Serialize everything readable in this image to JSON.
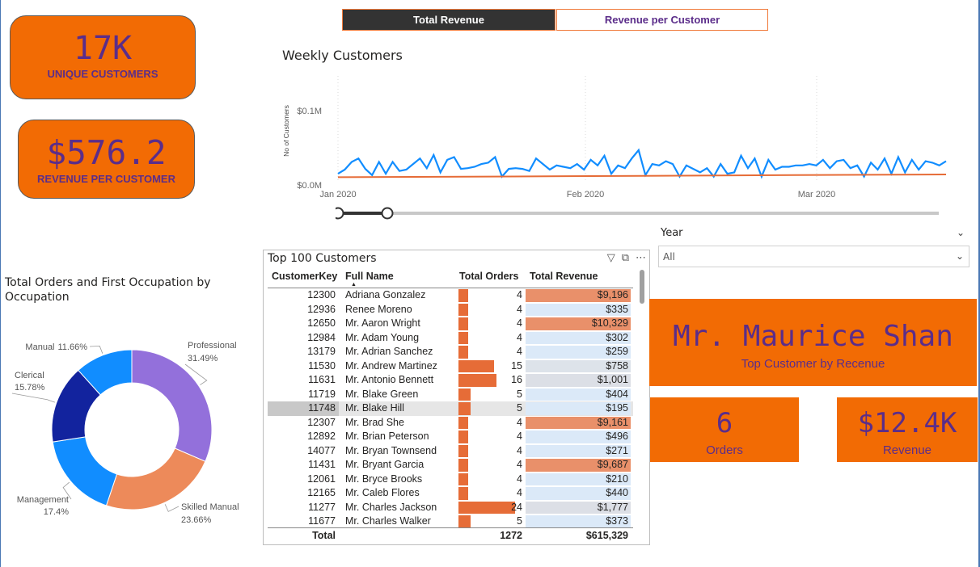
{
  "kpis": {
    "unique_customers": {
      "value": "17K",
      "label": "UNIQUE CUSTOMERS"
    },
    "revenue_per_customer": {
      "value": "$576.2",
      "label": "REVENUE PER CUSTOMER"
    }
  },
  "toggle": {
    "total_revenue": "Total Revenue",
    "revenue_per_customer": "Revenue per Customer",
    "active": "Total Revenue"
  },
  "weekly_chart": {
    "title": "Weekly Customers",
    "ylabel": "No of Customers",
    "y_ticks": [
      "$0.1M",
      "$0.0M"
    ],
    "x_ticks": [
      "Jan 2020",
      "Feb 2020",
      "Mar 2020"
    ]
  },
  "year_slicer": {
    "label": "Year",
    "value": "All"
  },
  "donut": {
    "title": "Total Orders and First Occupation by Occupation"
  },
  "table": {
    "title": "Top 100 Customers",
    "columns": [
      "CustomerKey",
      "Full Name",
      "Total Orders",
      "Total Revenue"
    ],
    "rows": [
      {
        "key": "12300",
        "name": "Adriana Gonzalez",
        "orders": 4,
        "revenue": "$9,196"
      },
      {
        "key": "12936",
        "name": "Renee Moreno",
        "orders": 4,
        "revenue": "$335"
      },
      {
        "key": "12650",
        "name": "Mr. Aaron Wright",
        "orders": 4,
        "revenue": "$10,329"
      },
      {
        "key": "12984",
        "name": "Mr. Adam Young",
        "orders": 4,
        "revenue": "$302"
      },
      {
        "key": "13179",
        "name": "Mr. Adrian Sanchez",
        "orders": 4,
        "revenue": "$259"
      },
      {
        "key": "11530",
        "name": "Mr. Andrew Martinez",
        "orders": 15,
        "revenue": "$758"
      },
      {
        "key": "11631",
        "name": "Mr. Antonio Bennett",
        "orders": 16,
        "revenue": "$1,001"
      },
      {
        "key": "11719",
        "name": "Mr. Blake Green",
        "orders": 5,
        "revenue": "$404"
      },
      {
        "key": "11748",
        "name": "Mr. Blake Hill",
        "orders": 5,
        "revenue": "$195"
      },
      {
        "key": "12307",
        "name": "Mr. Brad She",
        "orders": 4,
        "revenue": "$9,161"
      },
      {
        "key": "12892",
        "name": "Mr. Brian Peterson",
        "orders": 4,
        "revenue": "$496"
      },
      {
        "key": "14077",
        "name": "Mr. Bryan Townsend",
        "orders": 4,
        "revenue": "$271"
      },
      {
        "key": "11431",
        "name": "Mr. Bryant Garcia",
        "orders": 4,
        "revenue": "$9,687"
      },
      {
        "key": "12061",
        "name": "Mr. Bryce Brooks",
        "orders": 4,
        "revenue": "$210"
      },
      {
        "key": "12165",
        "name": "Mr. Caleb Flores",
        "orders": 4,
        "revenue": "$440"
      },
      {
        "key": "11277",
        "name": "Mr. Charles Jackson",
        "orders": 24,
        "revenue": "$1,777"
      },
      {
        "key": "11677",
        "name": "Mr. Charles Walker",
        "orders": 5,
        "revenue": "$373"
      }
    ],
    "total": {
      "label": "Total",
      "orders": "1272",
      "revenue": "$615,329"
    }
  },
  "top_customer": {
    "name": "Mr. Maurice Shan",
    "name_label": "Top Customer by Recenue",
    "orders": "6",
    "orders_label": "Orders",
    "revenue": "$12.4K",
    "revenue_label": "Revenue"
  },
  "colors": {
    "accent_orange": "#f26b04",
    "purple_text": "#5b2d8a",
    "line_blue": "#118dff",
    "line_orange": "#e66c37"
  },
  "chart_data": [
    {
      "type": "line",
      "title": "Weekly Customers",
      "ylabel": "No of Customers",
      "ylim": [
        0,
        0.12
      ],
      "y_unit": "$M",
      "x_ticks": [
        "Jan 2020",
        "Feb 2020",
        "Mar 2020"
      ],
      "series": [
        {
          "values": [
            0.008,
            0.014,
            0.025,
            0.03,
            0.015,
            0.006,
            0.025,
            0.008,
            0.025,
            0.012,
            0.014,
            0.022,
            0.03,
            0.016,
            0.035,
            0.01,
            0.028,
            0.032,
            0.015,
            0.016,
            0.018,
            0.022,
            0.024,
            0.032,
            0.004,
            0.015,
            0.016,
            0.015,
            0.012,
            0.03,
            0.022,
            0.014,
            0.02,
            0.018,
            0.016,
            0.022,
            0.014,
            0.028,
            0.02,
            0.034,
            0.008,
            0.02,
            0.016,
            0.03,
            0.042,
            0.006,
            0.022,
            0.02,
            0.026,
            0.022,
            0.004,
            0.02,
            0.015,
            0.01,
            0.016,
            0.004,
            0.022,
            0.008,
            0.01,
            0.034,
            0.016,
            0.03,
            0.004,
            0.028,
            0.014,
            0.018,
            0.018,
            0.02,
            0.02,
            0.022,
            0.02,
            0.028,
            0.016,
            0.026,
            0.028,
            0.016,
            0.02,
            0.004,
            0.024,
            0.014,
            0.03,
            0.008,
            0.032,
            0.01,
            0.028,
            0.014,
            0.026,
            0.024,
            0.02,
            0.026
          ]
        },
        {
          "values": [
            0.003,
            0.0035,
            0.004,
            0.0045,
            0.005,
            0.0055,
            0.006,
            0.0065,
            0.007
          ]
        }
      ]
    },
    {
      "type": "pie",
      "title": "Total Orders and First Occupation by Occupation",
      "categories": [
        "Professional",
        "Skilled Manual",
        "Management",
        "Clerical",
        "Manual"
      ],
      "values": [
        31.49,
        23.66,
        17.4,
        15.78,
        11.66
      ],
      "labels": [
        "31.49%",
        "23.66%",
        "17.4%",
        "15.78%",
        "11.66%"
      ],
      "colors": [
        "#9370db",
        "#ed8a5a",
        "#118dff",
        "#12239e",
        "#118dff"
      ]
    }
  ]
}
